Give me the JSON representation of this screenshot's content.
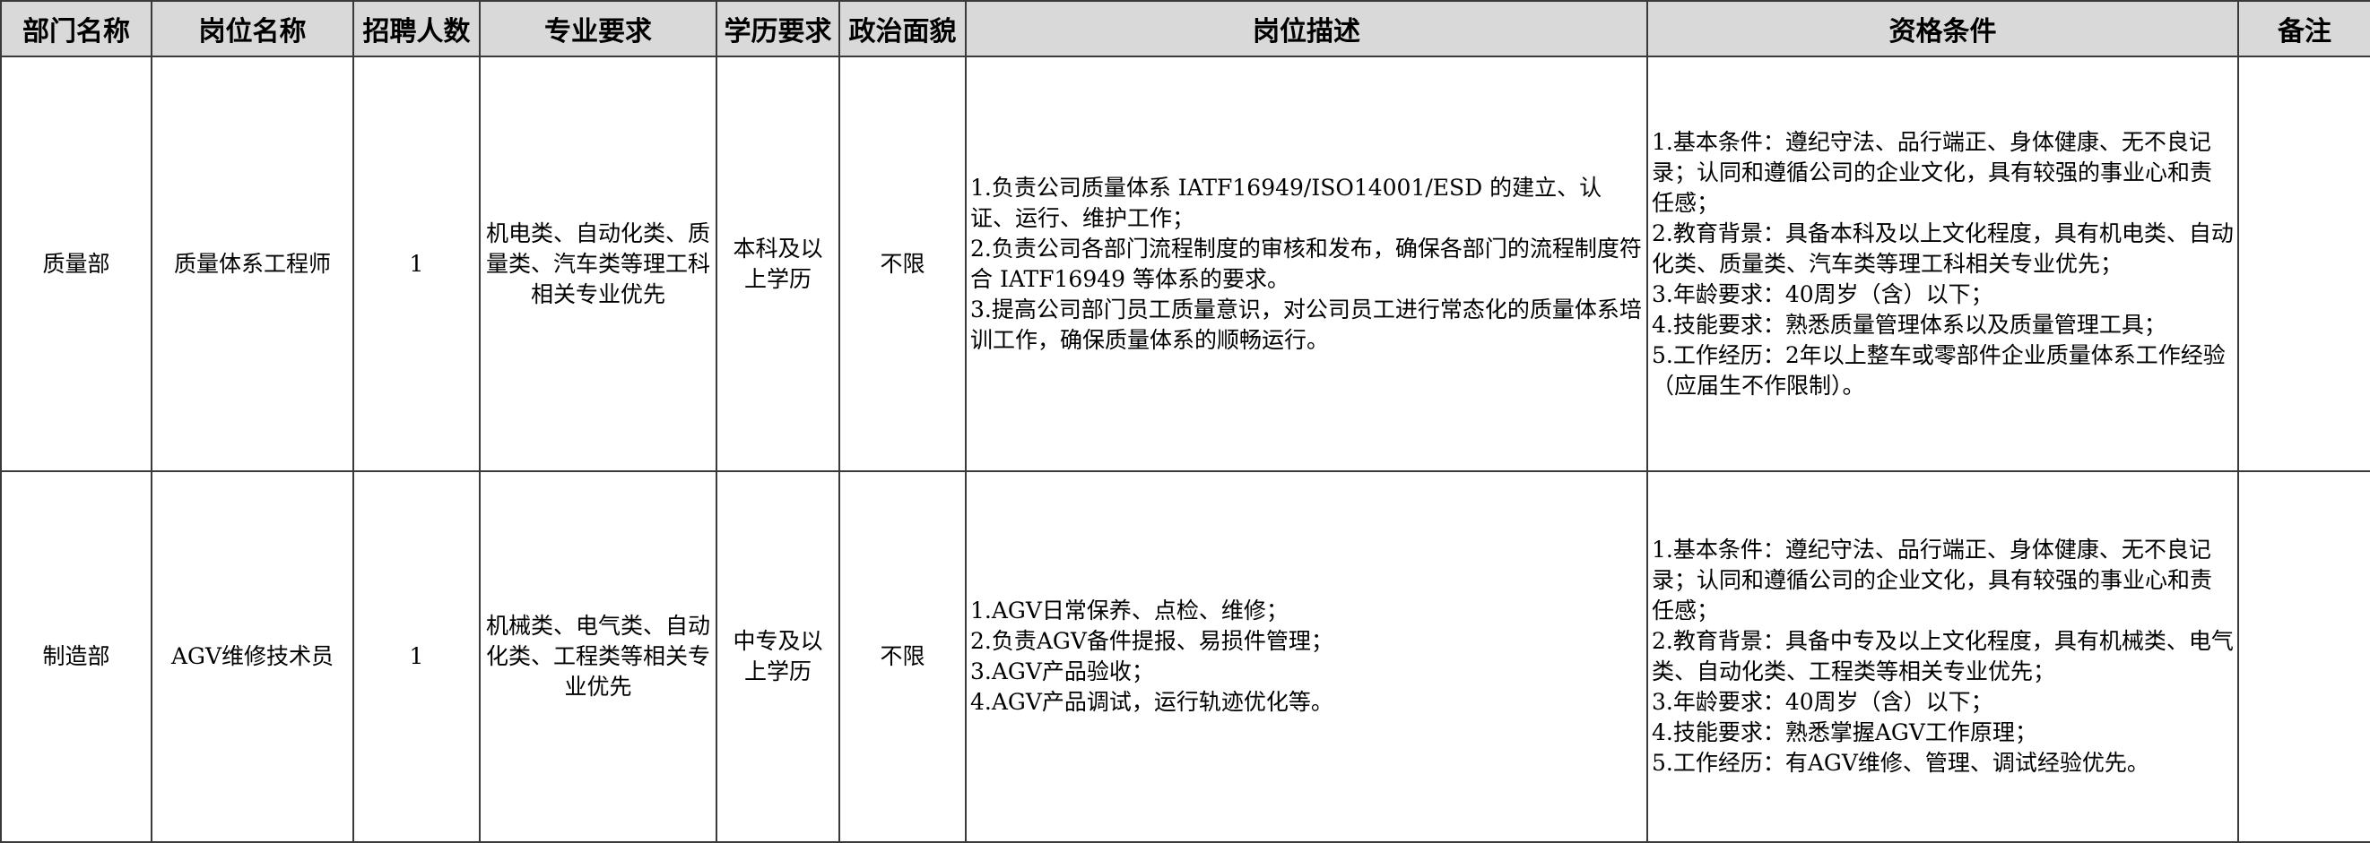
{
  "headers": [
    "部门名称",
    "岗位名称",
    "招聘人数",
    "专业要求",
    "学历要求",
    "政治面貌",
    "岗位描述",
    "资格条件",
    "备注"
  ],
  "rows": [
    {
      "department": "质量部",
      "position": "质量体系工程师",
      "count": "1",
      "major": "机电类、自动化类、质量类、汽车类等理工科相关专业优先",
      "education": "本科及以上学历",
      "political": "不限",
      "description": [
        "1.负责公司质量体系 IATF16949/ISO14001/ESD 的建立、认证、运行、维护工作；",
        "2.负责公司各部门流程制度的审核和发布，确保各部门的流程制度符合 IATF16949 等体系的要求。",
        "3.提高公司部门员工质量意识，对公司员工进行常态化的质量体系培训工作，确保质量体系的顺畅运行。"
      ],
      "qualifications": [
        "1.基本条件：遵纪守法、品行端正、身体健康、无不良记录；认同和遵循公司的企业文化，具有较强的事业心和责任感；",
        "2.教育背景：具备本科及以上文化程度，具有机电类、自动化类、质量类、汽车类等理工科相关专业优先；",
        "3.年龄要求：40周岁（含）以下；",
        "4.技能要求：熟悉质量管理体系以及质量管理工具；",
        "5.工作经历：2年以上整车或零部件企业质量体系工作经验（应届生不作限制）。"
      ],
      "remarks": ""
    },
    {
      "department": "制造部",
      "position": "AGV维修技术员",
      "count": "1",
      "major": "机械类、电气类、自动化类、工程类等相关专业优先",
      "education": "中专及以上学历",
      "political": "不限",
      "description": [
        "1.AGV日常保养、点检、维修；",
        "2.负责AGV备件提报、易损件管理；",
        "3.AGV产品验收；",
        "4.AGV产品调试，运行轨迹优化等。"
      ],
      "qualifications": [
        "1.基本条件：遵纪守法、品行端正、身体健康、无不良记录；认同和遵循公司的企业文化，具有较强的事业心和责任感；",
        "2.教育背景：具备中专及以上文化程度，具有机械类、电气类、自动化类、工程类等相关专业优先；",
        "3.年龄要求：40周岁（含）以下；",
        "4.技能要求：熟悉掌握AGV工作原理；",
        "5.工作经历：有AGV维修、管理、调试经验优先。"
      ],
      "remarks": ""
    }
  ]
}
